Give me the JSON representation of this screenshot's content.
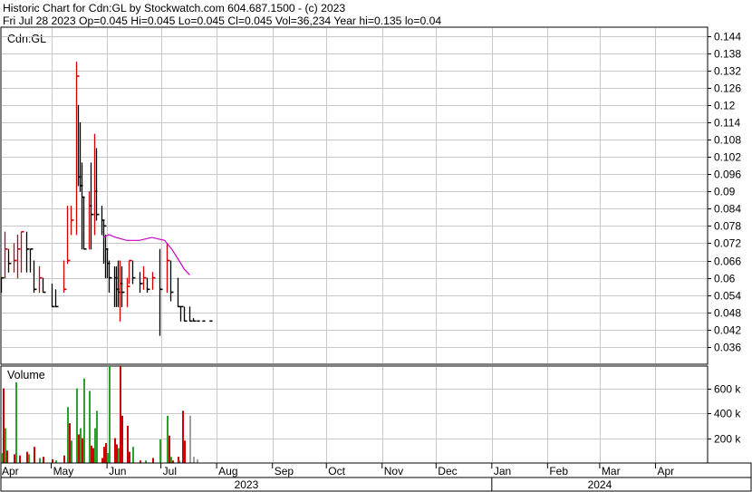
{
  "header": {
    "line1": "Historic Chart for Cdn:GL by Stockwatch.com 604.687.1500 - (c) 2023",
    "line2": "Fri Jul 28 2023   Op=0.045   Hi=0.045   Lo=0.045   Cl=0.045   Vol=36,234   Year hi=0.135   lo=0.04"
  },
  "colors": {
    "up": "#cc0000",
    "down": "#000000",
    "ma": "#cc00cc",
    "grid": "#c8c8c8",
    "vol_up": "#2ca02c",
    "vol_down": "#cc0000",
    "vol_flat": "#a0a0a0"
  },
  "chart_data": [
    {
      "type": "ohlc",
      "title": "Cdn:GL",
      "ylim": [
        0.03,
        0.147
      ],
      "y_ticks": [
        "0.144",
        "0.138",
        "0.132",
        "0.126",
        "0.12",
        "0.114",
        "0.108",
        "0.102",
        "0.096",
        "0.09",
        "0.084",
        "0.078",
        "0.072",
        "0.066",
        "0.06",
        "0.054",
        "0.048",
        "0.042",
        "0.036"
      ],
      "grid": true,
      "bars": [
        {
          "x": "2023-04-03",
          "h": 0.06,
          "l": 0.055,
          "c": 0.06
        },
        {
          "x": "2023-04-05",
          "h": 0.076,
          "l": 0.06,
          "c": 0.07
        },
        {
          "x": "2023-04-07",
          "h": 0.07,
          "l": 0.062,
          "c": 0.065
        },
        {
          "x": "2023-04-10",
          "h": 0.072,
          "l": 0.062,
          "c": 0.066
        },
        {
          "x": "2023-04-12",
          "h": 0.075,
          "l": 0.06,
          "c": 0.07
        },
        {
          "x": "2023-04-14",
          "h": 0.076,
          "l": 0.062,
          "c": 0.076
        },
        {
          "x": "2023-04-17",
          "h": 0.076,
          "l": 0.062,
          "c": 0.07
        },
        {
          "x": "2023-04-19",
          "h": 0.07,
          "l": 0.062,
          "c": 0.07
        },
        {
          "x": "2023-04-21",
          "h": 0.066,
          "l": 0.055,
          "c": 0.056
        },
        {
          "x": "2023-04-24",
          "h": 0.064,
          "l": 0.055,
          "c": 0.06
        },
        {
          "x": "2023-04-26",
          "h": 0.06,
          "l": 0.055,
          "c": 0.055
        },
        {
          "x": "2023-05-01",
          "h": 0.058,
          "l": 0.05,
          "c": 0.05
        },
        {
          "x": "2023-05-03",
          "h": 0.056,
          "l": 0.05,
          "c": 0.05
        },
        {
          "x": "2023-05-08",
          "h": 0.066,
          "l": 0.055,
          "c": 0.056
        },
        {
          "x": "2023-05-10",
          "h": 0.085,
          "l": 0.065,
          "c": 0.066
        },
        {
          "x": "2023-05-12",
          "h": 0.085,
          "l": 0.075,
          "c": 0.08
        },
        {
          "x": "2023-05-15",
          "h": 0.135,
          "l": 0.075,
          "c": 0.13
        },
        {
          "x": "2023-05-16",
          "h": 0.12,
          "l": 0.092,
          "c": 0.095
        },
        {
          "x": "2023-05-17",
          "h": 0.114,
          "l": 0.09,
          "c": 0.092
        },
        {
          "x": "2023-05-18",
          "h": 0.1,
          "l": 0.07,
          "c": 0.088
        },
        {
          "x": "2023-05-19",
          "h": 0.088,
          "l": 0.07,
          "c": 0.07
        },
        {
          "x": "2023-05-22",
          "h": 0.09,
          "l": 0.07,
          "c": 0.085
        },
        {
          "x": "2023-05-23",
          "h": 0.1,
          "l": 0.07,
          "c": 0.082
        },
        {
          "x": "2023-05-25",
          "h": 0.11,
          "l": 0.075,
          "c": 0.09
        },
        {
          "x": "2023-05-26",
          "h": 0.105,
          "l": 0.08,
          "c": 0.082
        },
        {
          "x": "2023-05-29",
          "h": 0.085,
          "l": 0.075,
          "c": 0.08
        },
        {
          "x": "2023-05-30",
          "h": 0.08,
          "l": 0.065,
          "c": 0.078
        },
        {
          "x": "2023-05-31",
          "h": 0.075,
          "l": 0.06,
          "c": 0.07
        },
        {
          "x": "2023-06-01",
          "h": 0.07,
          "l": 0.06,
          "c": 0.065
        },
        {
          "x": "2023-06-02",
          "h": 0.066,
          "l": 0.055,
          "c": 0.06
        },
        {
          "x": "2023-06-05",
          "h": 0.064,
          "l": 0.05,
          "c": 0.06
        },
        {
          "x": "2023-06-06",
          "h": 0.064,
          "l": 0.05,
          "c": 0.056
        },
        {
          "x": "2023-06-07",
          "h": 0.066,
          "l": 0.05,
          "c": 0.055
        },
        {
          "x": "2023-06-08",
          "h": 0.066,
          "l": 0.045,
          "c": 0.058
        },
        {
          "x": "2023-06-09",
          "h": 0.064,
          "l": 0.05,
          "c": 0.055
        },
        {
          "x": "2023-06-12",
          "h": 0.06,
          "l": 0.05,
          "c": 0.057
        },
        {
          "x": "2023-06-13",
          "h": 0.066,
          "l": 0.058,
          "c": 0.066
        },
        {
          "x": "2023-06-15",
          "h": 0.066,
          "l": 0.058,
          "c": 0.06
        },
        {
          "x": "2023-06-19",
          "h": 0.062,
          "l": 0.055,
          "c": 0.058
        },
        {
          "x": "2023-06-21",
          "h": 0.064,
          "l": 0.056,
          "c": 0.06
        },
        {
          "x": "2023-06-23",
          "h": 0.06,
          "l": 0.055,
          "c": 0.056
        },
        {
          "x": "2023-06-26",
          "h": 0.062,
          "l": 0.056,
          "c": 0.06
        },
        {
          "x": "2023-06-30",
          "h": 0.07,
          "l": 0.04,
          "c": 0.056
        },
        {
          "x": "2023-07-04",
          "h": 0.072,
          "l": 0.055,
          "c": 0.066
        },
        {
          "x": "2023-07-06",
          "h": 0.066,
          "l": 0.052,
          "c": 0.055
        },
        {
          "x": "2023-07-10",
          "h": 0.06,
          "l": 0.05,
          "c": 0.05
        },
        {
          "x": "2023-07-12",
          "h": 0.05,
          "l": 0.045,
          "c": 0.05
        },
        {
          "x": "2023-07-14",
          "h": 0.05,
          "l": 0.045,
          "c": 0.045
        },
        {
          "x": "2023-07-17",
          "h": 0.05,
          "l": 0.045,
          "c": 0.045
        },
        {
          "x": "2023-07-19",
          "h": 0.046,
          "l": 0.045,
          "c": 0.045
        },
        {
          "x": "2023-07-21",
          "h": 0.045,
          "l": 0.045,
          "c": 0.045
        },
        {
          "x": "2023-07-24",
          "h": 0.045,
          "l": 0.045,
          "c": 0.045
        },
        {
          "x": "2023-07-28",
          "h": 0.045,
          "l": 0.045,
          "c": 0.045
        }
      ],
      "moving_average": [
        {
          "x": "2023-05-30",
          "y": 0.074
        },
        {
          "x": "2023-06-02",
          "y": 0.075
        },
        {
          "x": "2023-06-06",
          "y": 0.074
        },
        {
          "x": "2023-06-12",
          "y": 0.073
        },
        {
          "x": "2023-06-19",
          "y": 0.073
        },
        {
          "x": "2023-06-26",
          "y": 0.074
        },
        {
          "x": "2023-07-03",
          "y": 0.073
        },
        {
          "x": "2023-07-07",
          "y": 0.07
        },
        {
          "x": "2023-07-11",
          "y": 0.066
        },
        {
          "x": "2023-07-14",
          "y": 0.063
        },
        {
          "x": "2023-07-17",
          "y": 0.061
        }
      ]
    },
    {
      "type": "bar",
      "title": "Volume",
      "ylim": [
        0,
        780000
      ],
      "y_ticks": [
        {
          "value": 600000,
          "label": "600 k"
        },
        {
          "value": 400000,
          "label": "400 k"
        },
        {
          "value": 200000,
          "label": "200 k"
        }
      ],
      "bars": [
        {
          "x": "2023-04-03",
          "v": 80000,
          "dir": "up"
        },
        {
          "x": "2023-04-04",
          "v": 600000,
          "dir": "down"
        },
        {
          "x": "2023-04-05",
          "v": 280000,
          "dir": "up"
        },
        {
          "x": "2023-04-06",
          "v": 100000,
          "dir": "down"
        },
        {
          "x": "2023-04-10",
          "v": 70000,
          "dir": "down"
        },
        {
          "x": "2023-04-11",
          "v": 650000,
          "dir": "up"
        },
        {
          "x": "2023-04-13",
          "v": 60000,
          "dir": "down"
        },
        {
          "x": "2023-04-17",
          "v": 90000,
          "dir": "down"
        },
        {
          "x": "2023-04-18",
          "v": 70000,
          "dir": "up"
        },
        {
          "x": "2023-04-21",
          "v": 130000,
          "dir": "down"
        },
        {
          "x": "2023-04-24",
          "v": 40000,
          "dir": "up"
        },
        {
          "x": "2023-04-26",
          "v": 50000,
          "dir": "down"
        },
        {
          "x": "2023-05-01",
          "v": 30000,
          "dir": "down"
        },
        {
          "x": "2023-05-03",
          "v": 20000,
          "dir": "up"
        },
        {
          "x": "2023-05-08",
          "v": 60000,
          "dir": "down"
        },
        {
          "x": "2023-05-10",
          "v": 450000,
          "dir": "up"
        },
        {
          "x": "2023-05-11",
          "v": 320000,
          "dir": "down"
        },
        {
          "x": "2023-05-12",
          "v": 180000,
          "dir": "up"
        },
        {
          "x": "2023-05-15",
          "v": 600000,
          "dir": "up"
        },
        {
          "x": "2023-05-16",
          "v": 230000,
          "dir": "down"
        },
        {
          "x": "2023-05-17",
          "v": 280000,
          "dir": "up"
        },
        {
          "x": "2023-05-18",
          "v": 200000,
          "dir": "down"
        },
        {
          "x": "2023-05-19",
          "v": 680000,
          "dir": "up"
        },
        {
          "x": "2023-05-22",
          "v": 580000,
          "dir": "up"
        },
        {
          "x": "2023-05-23",
          "v": 140000,
          "dir": "down"
        },
        {
          "x": "2023-05-24",
          "v": 120000,
          "dir": "down"
        },
        {
          "x": "2023-05-25",
          "v": 280000,
          "dir": "up"
        },
        {
          "x": "2023-05-26",
          "v": 420000,
          "dir": "up"
        },
        {
          "x": "2023-05-29",
          "v": 40000,
          "dir": "down"
        },
        {
          "x": "2023-05-30",
          "v": 130000,
          "dir": "down"
        },
        {
          "x": "2023-05-31",
          "v": 160000,
          "dir": "down"
        },
        {
          "x": "2023-06-01",
          "v": 80000,
          "dir": "up"
        },
        {
          "x": "2023-06-02",
          "v": 780000,
          "dir": "up"
        },
        {
          "x": "2023-06-05",
          "v": 200000,
          "dir": "down"
        },
        {
          "x": "2023-06-06",
          "v": 150000,
          "dir": "down"
        },
        {
          "x": "2023-06-07",
          "v": 120000,
          "dir": "up"
        },
        {
          "x": "2023-06-08",
          "v": 780000,
          "dir": "down"
        },
        {
          "x": "2023-06-09",
          "v": 380000,
          "dir": "down"
        },
        {
          "x": "2023-06-12",
          "v": 300000,
          "dir": "down"
        },
        {
          "x": "2023-06-13",
          "v": 90000,
          "dir": "down"
        },
        {
          "x": "2023-06-15",
          "v": 130000,
          "dir": "up"
        },
        {
          "x": "2023-06-19",
          "v": 20000,
          "dir": "down"
        },
        {
          "x": "2023-06-22",
          "v": 20000,
          "dir": "up"
        },
        {
          "x": "2023-06-26",
          "v": 40000,
          "dir": "down"
        },
        {
          "x": "2023-06-30",
          "v": 190000,
          "dir": "up"
        },
        {
          "x": "2023-07-04",
          "v": 380000,
          "dir": "up"
        },
        {
          "x": "2023-07-05",
          "v": 220000,
          "dir": "down"
        },
        {
          "x": "2023-07-06",
          "v": 50000,
          "dir": "up"
        },
        {
          "x": "2023-07-07",
          "v": 20000,
          "dir": "down"
        },
        {
          "x": "2023-07-10",
          "v": 50000,
          "dir": "down"
        },
        {
          "x": "2023-07-11",
          "v": 20000,
          "dir": "up"
        },
        {
          "x": "2023-07-13",
          "v": 420000,
          "dir": "down"
        },
        {
          "x": "2023-07-14",
          "v": 180000,
          "dir": "down"
        },
        {
          "x": "2023-07-17",
          "v": 380000,
          "dir": "flat"
        },
        {
          "x": "2023-07-19",
          "v": 50000,
          "dir": "flat"
        },
        {
          "x": "2023-07-21",
          "v": 30000,
          "dir": "flat"
        }
      ]
    }
  ],
  "x_axis": {
    "months": [
      {
        "label": "Apr",
        "date": "2023-04-01"
      },
      {
        "label": "May",
        "date": "2023-05-01"
      },
      {
        "label": "Jun",
        "date": "2023-06-01"
      },
      {
        "label": "Jul",
        "date": "2023-07-01"
      },
      {
        "label": "Aug",
        "date": "2023-08-01"
      },
      {
        "label": "Sep",
        "date": "2023-09-01"
      },
      {
        "label": "Oct",
        "date": "2023-10-01"
      },
      {
        "label": "Nov",
        "date": "2023-11-01"
      },
      {
        "label": "Dec",
        "date": "2023-12-01"
      },
      {
        "label": "Jan",
        "date": "2024-01-01"
      },
      {
        "label": "Feb",
        "date": "2024-02-01"
      },
      {
        "label": "Mar",
        "date": "2024-03-01"
      },
      {
        "label": "Apr",
        "date": "2024-04-01"
      }
    ],
    "years": [
      {
        "label": "2023",
        "start": "2023-04-01",
        "end": "2024-01-01"
      },
      {
        "label": "2024",
        "start": "2024-01-01",
        "end": "2024-04-30"
      }
    ],
    "range": [
      "2023-04-03",
      "2024-04-30"
    ]
  }
}
